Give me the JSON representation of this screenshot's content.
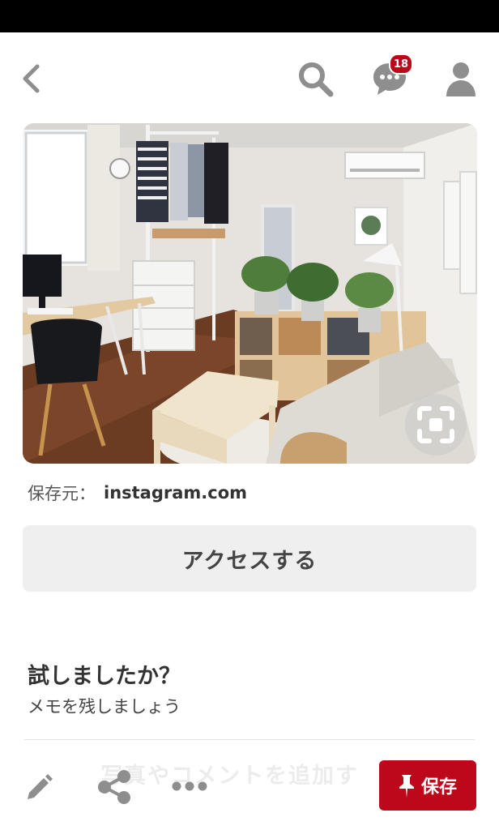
{
  "nav": {
    "back_icon": "chevron-left-icon",
    "search_icon": "search-icon",
    "messages_icon": "chat-bubble-icon",
    "messages_badge": "18",
    "profile_icon": "person-icon"
  },
  "pin": {
    "image_subject": "room-interior-photo",
    "visual_search_icon": "visual-search-icon"
  },
  "source": {
    "label": "保存元：",
    "domain": "instagram.com"
  },
  "access_button": {
    "label": "アクセスする"
  },
  "tried": {
    "title": "試しましたか？",
    "subtitle": "メモを残しましょう"
  },
  "comment": {
    "placeholder": "写真やコメントを追加す"
  },
  "bottom_bar": {
    "edit_icon": "pencil-icon",
    "share_icon": "share-icon",
    "more_icon": "more-dots-icon",
    "save_label": "保存",
    "save_icon": "pushpin-icon"
  },
  "colors": {
    "brand_red": "#bd081c",
    "icon_gray": "#8e8e8e",
    "button_bg": "#efefef"
  }
}
